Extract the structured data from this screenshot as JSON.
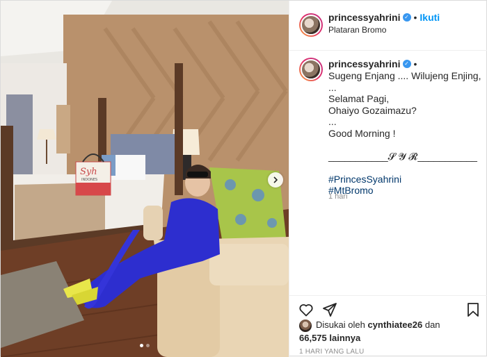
{
  "post": {
    "username": "princessyahrini",
    "follow_label": "Ikuti",
    "separator": "•",
    "location": "Plataran Bromo",
    "verified_glyph": "✓",
    "image_bag_text": "Syh",
    "image_bag_subtext": "INDONES",
    "carousel": {
      "total": 2,
      "active": 0
    }
  },
  "caption": {
    "username": "princessyahrini",
    "trailing_dot": "•",
    "lines": [
      "Sugeng Enjang .... Wilujeng Enjing,",
      "...",
      "Selamat Pagi,",
      "Ohaiyo Gozaimazu?",
      "...",
      "Good Morning !",
      "",
      "___________𝓢 𝓨 𝓡___________",
      "",
      "#PrincesSyahrini",
      "#MtBromo"
    ],
    "age": "1 hari"
  },
  "actions": {
    "icons": [
      "heart-icon",
      "share-icon",
      "bookmark-icon"
    ]
  },
  "likes": {
    "prefix": "Disukai oleh",
    "user": "cynthiatee26",
    "mid": "dan",
    "count": "66,575 lainnya"
  },
  "timestamp": "1 HARI YANG LALU",
  "colors": {
    "link": "#0095f6",
    "hashtag": "#00376b",
    "muted": "#8e8e8e",
    "verified": "#3897f0"
  }
}
